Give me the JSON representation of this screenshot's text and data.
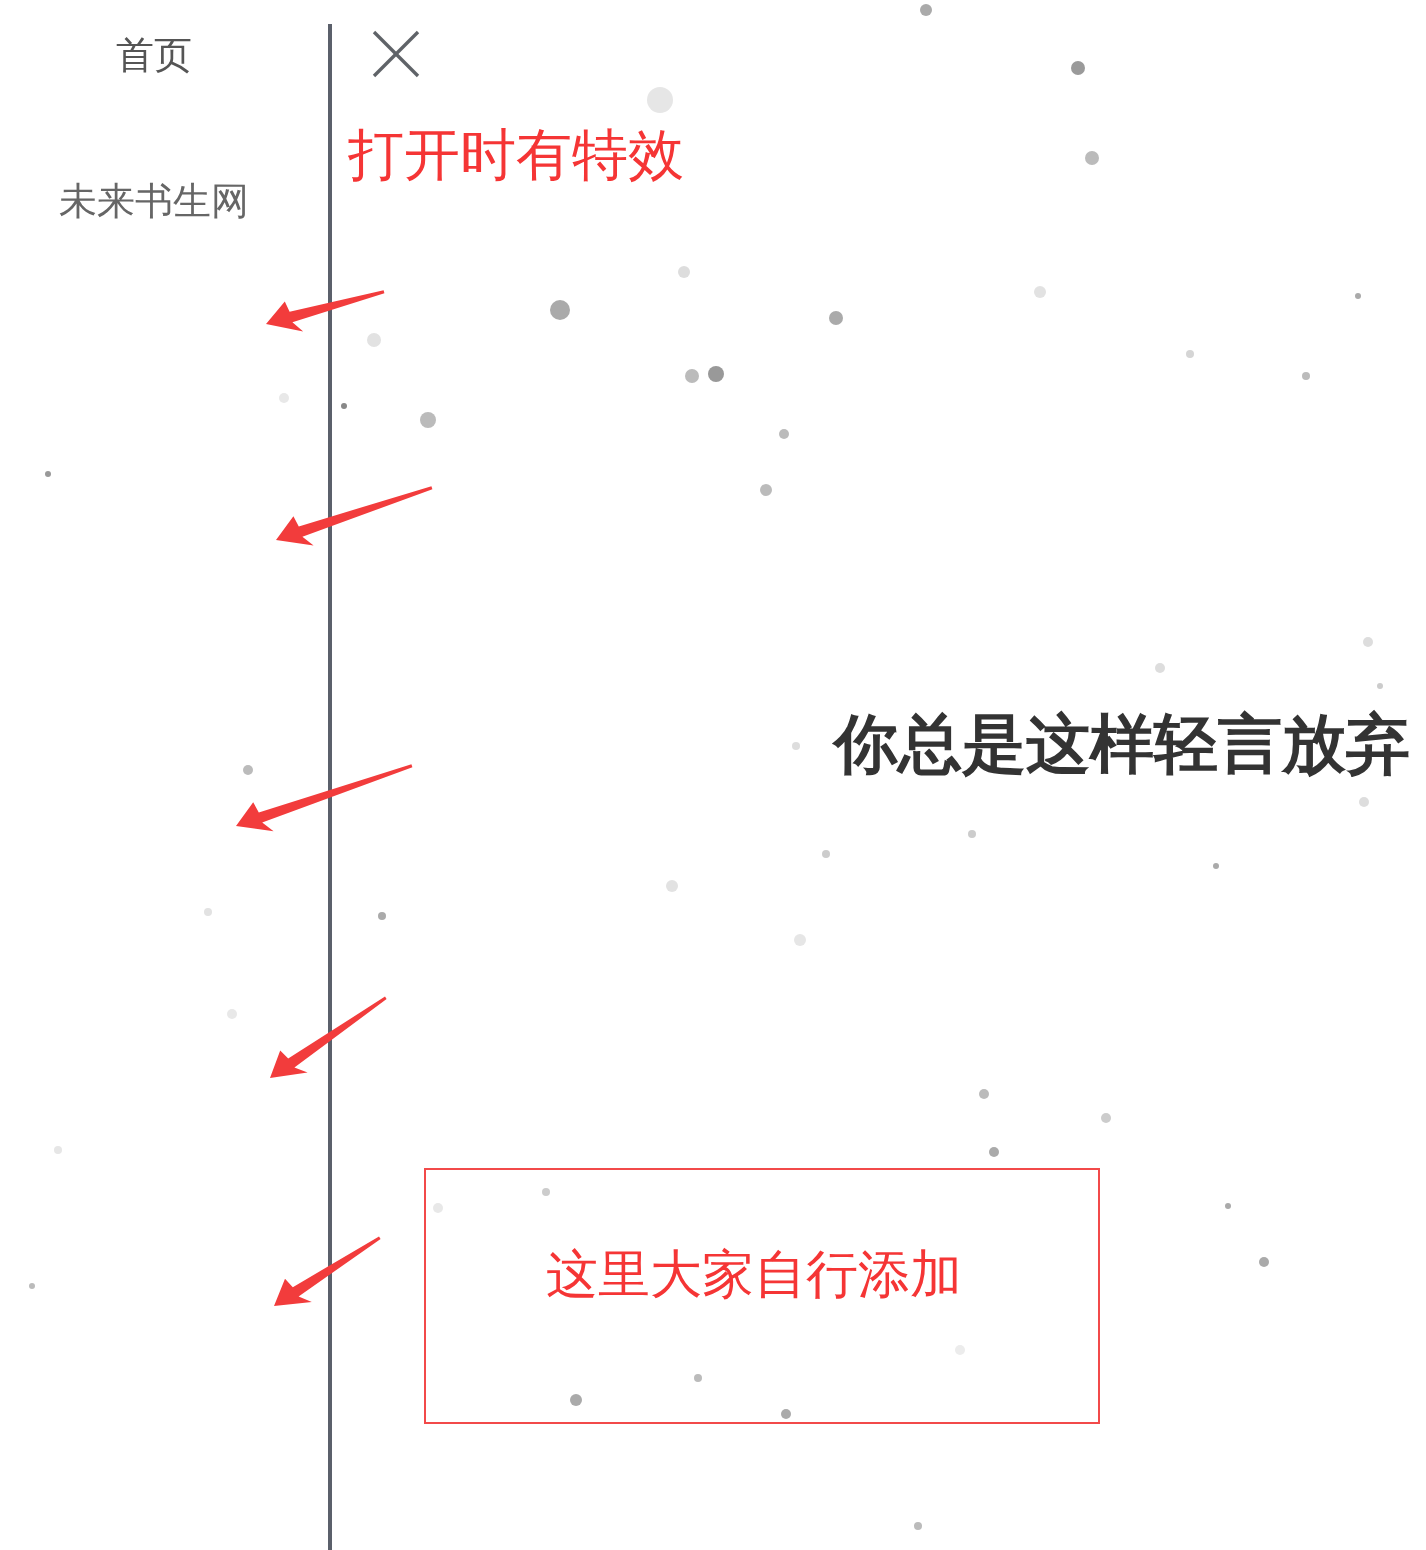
{
  "sidebar": {
    "items": [
      {
        "label": "首页"
      },
      {
        "label": "未来书生网"
      }
    ]
  },
  "note": "打开时有特效",
  "headline": "你总是这样轻言放弃",
  "custom_area": {
    "text": "这里大家自行添加"
  }
}
